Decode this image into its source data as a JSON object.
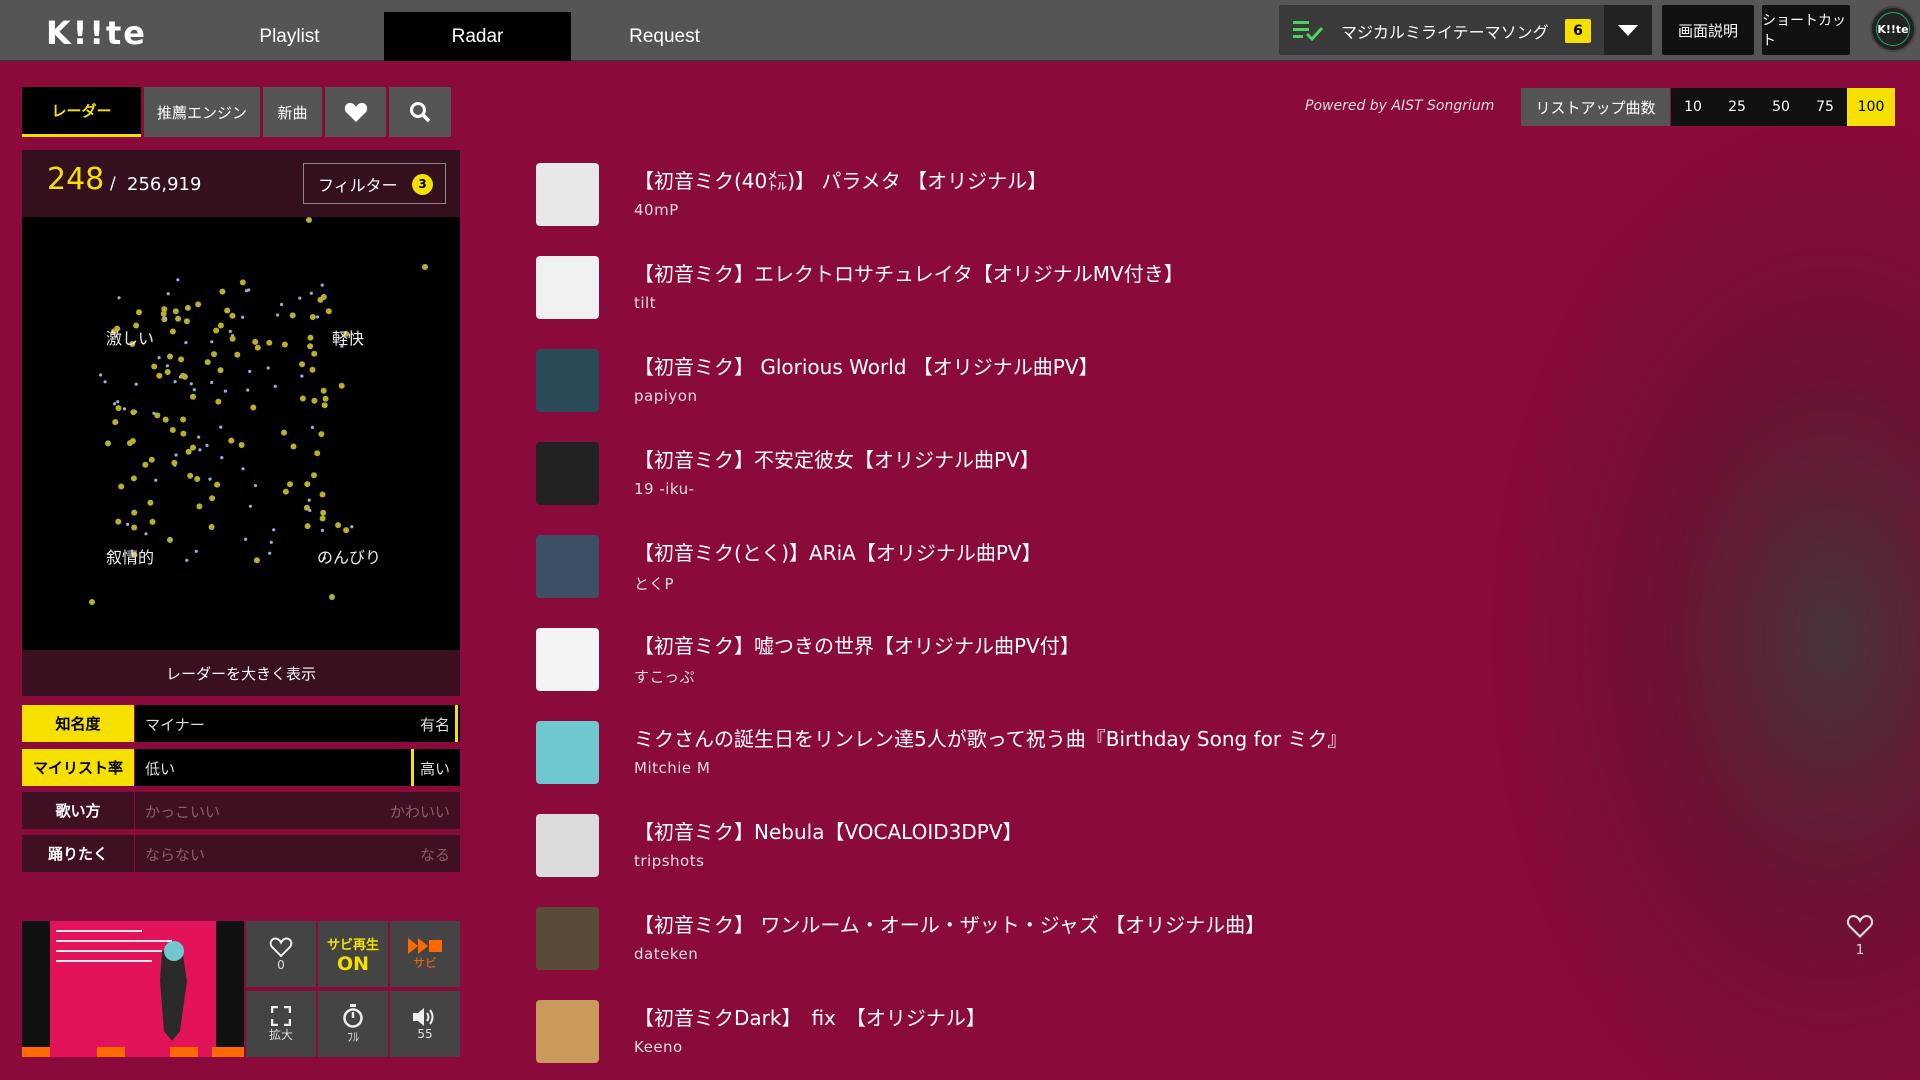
{
  "app": {
    "logo": "K!!te"
  },
  "nav": {
    "tabs": [
      "Playlist",
      "Radar",
      "Request"
    ],
    "active": "Radar"
  },
  "theme": {
    "label": "マジカルミライテーマソング",
    "count": "6"
  },
  "header_buttons": {
    "help": "画面説明",
    "shortcut": "ショートカット"
  },
  "avatar": {
    "label": "K!!te"
  },
  "left_tabs": {
    "radar": "レーダー",
    "engine": "推薦エンジン",
    "new": "新曲",
    "favorite_icon": "heart-icon",
    "search_icon": "search-icon"
  },
  "radar": {
    "count": "248",
    "separator": "/",
    "total": "256,919",
    "filter_label": "フィルター",
    "filter_count": "3",
    "labels": {
      "top_left": "激しい",
      "top_right": "軽快",
      "bottom_left": "叙情的",
      "bottom_right": "のんびり"
    },
    "expand_label": "レーダーを大きく表示"
  },
  "sliders": [
    {
      "name": "知名度",
      "low": "マイナー",
      "high": "有名",
      "active": true,
      "value": 1.0
    },
    {
      "name": "マイリスト率",
      "low": "低い",
      "high": "高い",
      "active": true,
      "value": 0.9
    },
    {
      "name": "歌い方",
      "low": "かっこいい",
      "high": "かわいい",
      "active": false
    },
    {
      "name": "踊りたく",
      "low": "ならない",
      "high": "なる",
      "active": false
    }
  ],
  "player": {
    "like_count": "0",
    "sabi_label": "サビ再生",
    "sabi_state": "ON",
    "sabi_skip_label": "サビ",
    "expand_label": "拡大",
    "timer_label": "ﾌﾙ",
    "volume": "55"
  },
  "listup": {
    "powered_by": "Powered by AIST Songrium",
    "label": "リストアップ曲数",
    "options": [
      "10",
      "25",
      "50",
      "75",
      "100"
    ],
    "selected": "100"
  },
  "songs": [
    {
      "title": "【初音ミク(40㍍)】 パラメタ 【オリジナル】",
      "artist": "40mP",
      "thumb_color": "#e8e8e8"
    },
    {
      "title": "【初音ミク】エレクトロサチュレイタ【オリジナルMV付き】",
      "artist": "tilt",
      "thumb_color": "#f0f0f0"
    },
    {
      "title": "【初音ミク】 Glorious World 【オリジナル曲PV】",
      "artist": "papiyon",
      "thumb_color": "#2a4a55"
    },
    {
      "title": "【初音ミク】不安定彼女【オリジナル曲PV】",
      "artist": "19 -iku-",
      "thumb_color": "#222222"
    },
    {
      "title": "【初音ミク(とく)】ARiA【オリジナル曲PV】",
      "artist": "とくP",
      "thumb_color": "#3d4f63"
    },
    {
      "title": "【初音ミク】嘘つきの世界【オリジナル曲PV付】",
      "artist": "すこっぷ",
      "thumb_color": "#f4f4f4"
    },
    {
      "title": "ミクさんの誕生日をリンレン達5人が歌って祝う曲『Birthday Song for ミク』",
      "artist": "Mitchie M",
      "thumb_color": "#6fc7cf"
    },
    {
      "title": "【初音ミク】Nebula【VOCALOID3DPV】",
      "artist": "tripshots",
      "thumb_color": "#dcdcdc"
    },
    {
      "title": "【初音ミク】 ワンルーム・オール・ザット・ジャズ 【オリジナル曲】",
      "artist": "dateken",
      "thumb_color": "#5a4a3a"
    },
    {
      "title": "【初音ミクDark】　fix　【オリジナル】",
      "artist": "Keeno",
      "thumb_color": "#c99a5a"
    }
  ],
  "favorite": {
    "icon": "heart-icon",
    "count": "1"
  }
}
